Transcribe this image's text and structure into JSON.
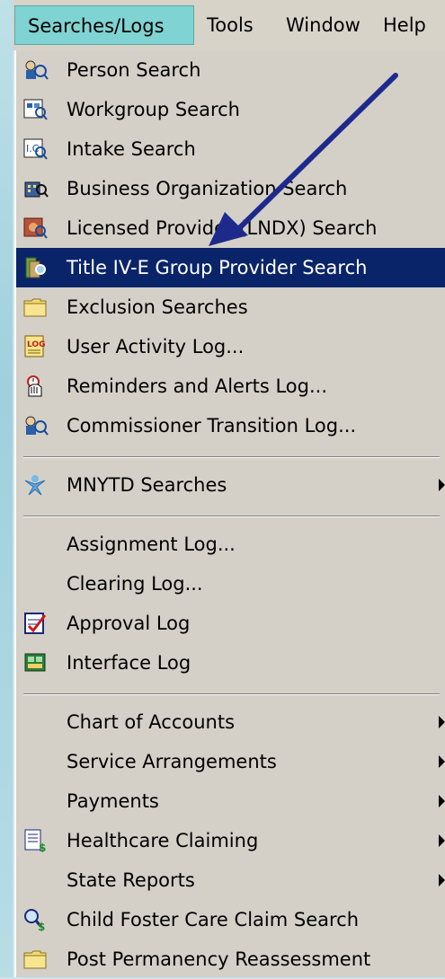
{
  "menubar": {
    "items": [
      {
        "label": "Searches/Logs"
      },
      {
        "label": "Tools"
      },
      {
        "label": "Window"
      },
      {
        "label": "Help"
      }
    ]
  },
  "menu": {
    "items": [
      {
        "label": "Person Search",
        "icon": "person-search-icon"
      },
      {
        "label": "Workgroup Search",
        "icon": "workgroup-search-icon"
      },
      {
        "label": "Intake Search",
        "icon": "intake-search-icon"
      },
      {
        "label": "Business Organization Search",
        "icon": "business-search-icon"
      },
      {
        "label": "Licensed Provider (LNDX) Search",
        "icon": "licensed-provider-icon"
      },
      {
        "label": "Title IV-E Group Provider Search",
        "icon": "group-provider-icon",
        "selected": true
      },
      {
        "label": "Exclusion Searches",
        "icon": "folder-icon"
      },
      {
        "label": "User Activity Log...",
        "icon": "log-icon"
      },
      {
        "label": "Reminders and Alerts Log...",
        "icon": "alarm-clock-icon"
      },
      {
        "label": "Commissioner Transition Log...",
        "icon": "person-search-icon"
      },
      {
        "label": "MNYTD Searches",
        "icon": "star-person-icon",
        "submenu": true
      },
      {
        "label": "Assignment Log..."
      },
      {
        "label": "Clearing Log..."
      },
      {
        "label": "Approval Log",
        "icon": "approval-checklist-icon"
      },
      {
        "label": "Interface Log",
        "icon": "interface-icon"
      },
      {
        "label": "Chart of Accounts",
        "submenu": true
      },
      {
        "label": "Service Arrangements",
        "submenu": true
      },
      {
        "label": "Payments",
        "submenu": true
      },
      {
        "label": "Healthcare Claiming",
        "icon": "healthcare-claim-icon",
        "submenu": true
      },
      {
        "label": "State Reports",
        "submenu": true
      },
      {
        "label": "Child Foster Care Claim Search",
        "icon": "claim-search-icon"
      },
      {
        "label": "Post Permanency Reassessment",
        "icon": "folder-icon"
      }
    ]
  },
  "colors": {
    "selection": "#0a246a",
    "menu_bg": "#d4d0c8",
    "active_menubar": "#7fd3d2",
    "annotation_arrow": "#1d2a8c"
  }
}
